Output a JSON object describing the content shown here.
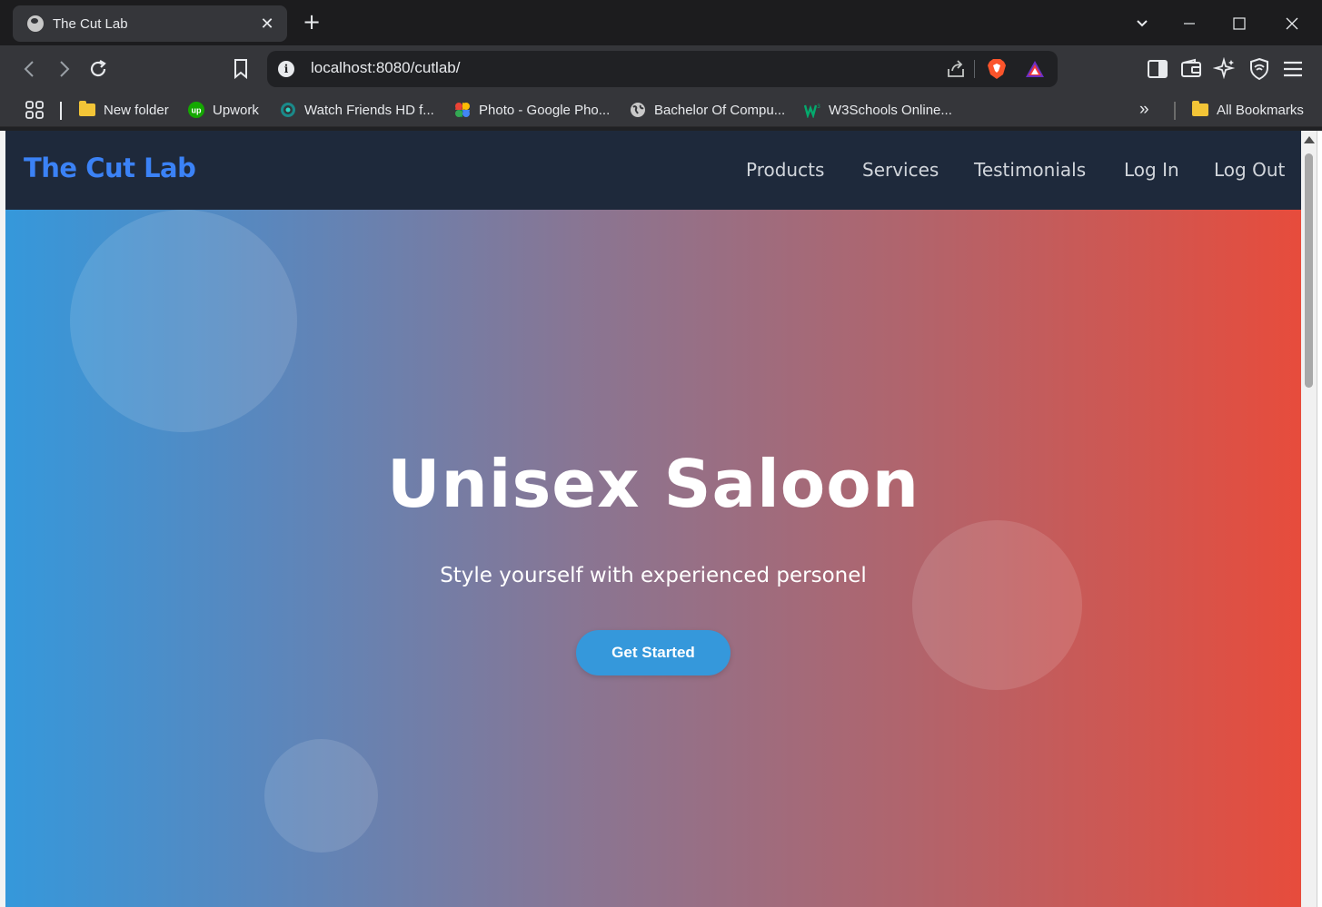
{
  "browser": {
    "tab_title": "The Cut Lab",
    "tab_close": "✕",
    "new_tab": "+",
    "url": "localhost:8080/cutlab/",
    "window_controls": {
      "dropdown": "⌄",
      "minimize": "—",
      "maximize": "☐",
      "close": "✕"
    }
  },
  "bookmarks": {
    "items": [
      {
        "label": "New folder",
        "icon": "folder-icon"
      },
      {
        "label": "Upwork",
        "icon": "upwork-icon"
      },
      {
        "label": "Watch Friends HD f...",
        "icon": "watch-icon"
      },
      {
        "label": "Photo - Google Pho...",
        "icon": "google-photos-icon"
      },
      {
        "label": "Bachelor Of Compu...",
        "icon": "globe-icon"
      },
      {
        "label": "W3Schools Online...",
        "icon": "w3schools-icon"
      }
    ],
    "overflow": "»",
    "all_bookmarks": "All Bookmarks"
  },
  "site": {
    "logo": "The Cut Lab",
    "nav": [
      "Products",
      "Services",
      "Testimonials",
      "Log In",
      "Log Out"
    ]
  },
  "hero": {
    "title": "Unisex Saloon",
    "subtitle": "Style yourself with experienced personel",
    "cta": "Get Started"
  },
  "colors": {
    "nav_bg": "#1e293b",
    "logo": "#3b82f6",
    "gradient_start": "#3598db",
    "gradient_end": "#e74c3c",
    "cta_bg": "#3598db"
  }
}
